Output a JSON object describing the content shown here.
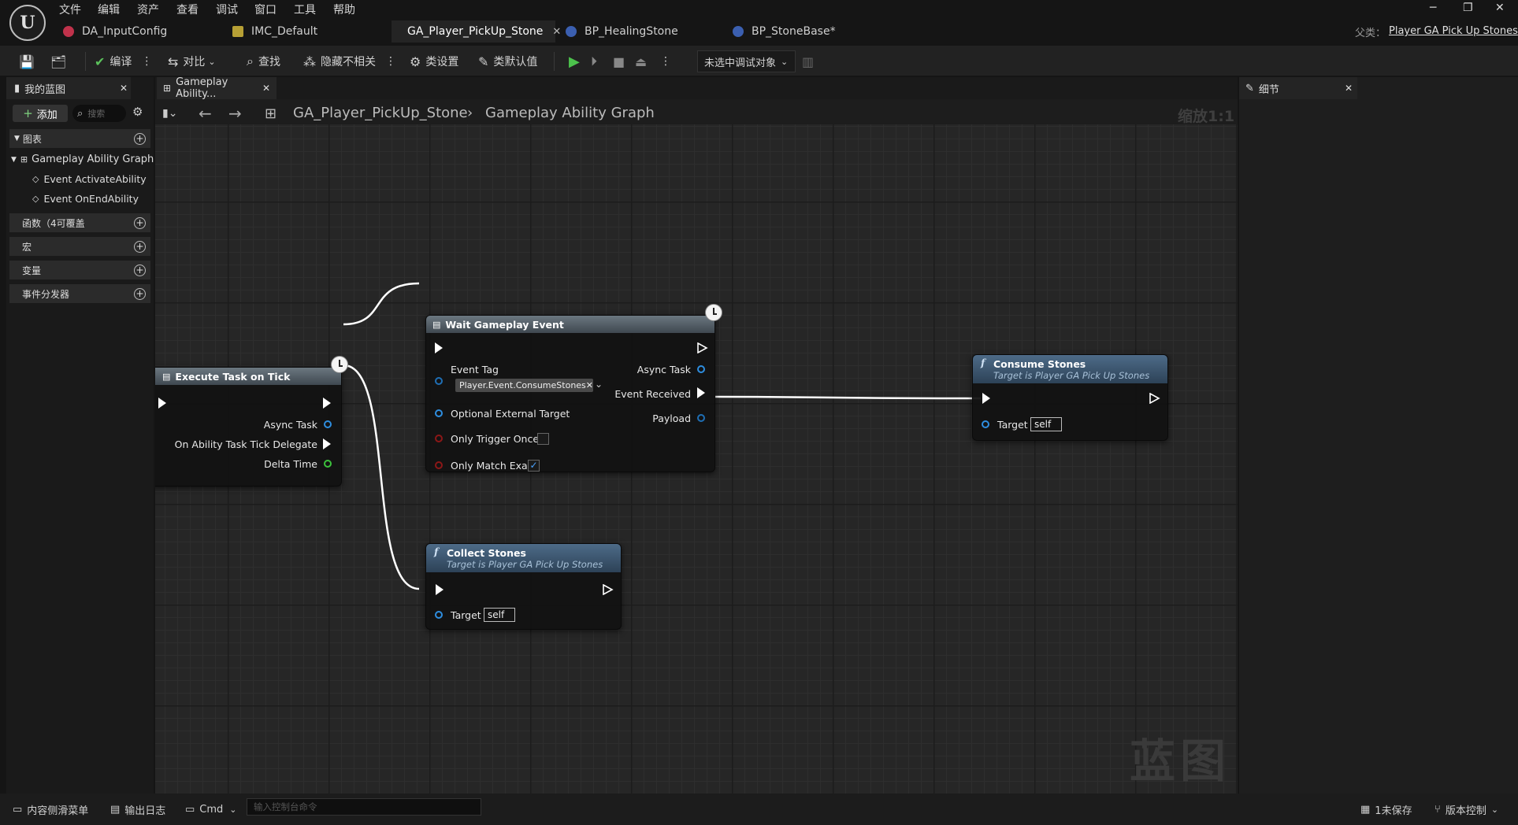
{
  "menu": [
    "文件",
    "编辑",
    "资产",
    "查看",
    "调试",
    "窗口",
    "工具",
    "帮助"
  ],
  "tabs": [
    {
      "label": "DA_InputConfig",
      "icon": "data-asset-icon",
      "color": "#c0324b",
      "active": false
    },
    {
      "label": "IMC_Default",
      "icon": "mapping-context-icon",
      "color": "#b7a035",
      "active": false
    },
    {
      "label": "GA_Player_PickUp_Stone",
      "icon": "blueprint-icon",
      "color": "#2f6fa8",
      "active": true
    },
    {
      "label": "BP_HealingStone",
      "icon": "blueprint-icon",
      "color": "#3b5fb0",
      "active": false
    },
    {
      "label": "BP_StoneBase*",
      "icon": "blueprint-icon",
      "color": "#3b5fb0",
      "active": false
    }
  ],
  "parent": {
    "label": "父类：",
    "value": "Player GA Pick Up Stones"
  },
  "toolbar": {
    "compile": "编译",
    "diff": "对比",
    "find": "查找",
    "hide_unrelated": "隐藏不相关",
    "class_settings": "类设置",
    "class_defaults": "类默认值",
    "debug_target": "未选中调试对象"
  },
  "left_panel": {
    "tab": "我的蓝图",
    "add": "添加",
    "search_placeholder": "搜索",
    "graphs_section": "图表",
    "graph_name": "Gameplay Ability Graph",
    "events": [
      "Event ActivateAbility",
      "Event OnEndAbility"
    ],
    "functions_section": "函数（4可覆盖",
    "macros_section": "宏",
    "variables_section": "变量",
    "dispatchers_section": "事件分发器"
  },
  "graph_tab": "Gameplay Ability...",
  "breadcrumb": {
    "asset": "GA_Player_PickUp_Stone",
    "graph": "Gameplay Ability Graph"
  },
  "zoom": "缩放1:1",
  "watermark": "蓝图",
  "nodes": {
    "execute_task": {
      "title": "Execute Task on Tick",
      "async_task": "Async Task",
      "delegate": "On Ability Task Tick Delegate",
      "delta_time": "Delta Time"
    },
    "wait_event": {
      "title": "Wait Gameplay Event",
      "event_tag": "Event Tag",
      "tag_value": "Player.Event.ConsumeStones",
      "async_task": "Async Task",
      "event_received": "Event Received",
      "payload": "Payload",
      "optional_target": "Optional External Target",
      "only_trigger_once": "Only Trigger Once",
      "only_match_exact": "Only Match Exact",
      "only_trigger_once_checked": false,
      "only_match_exact_checked": true
    },
    "consume": {
      "title": "Consume Stones",
      "subtitle": "Target is Player GA Pick Up Stones",
      "target": "Target",
      "target_value": "self"
    },
    "collect": {
      "title": "Collect Stones",
      "subtitle": "Target is Player GA Pick Up Stones",
      "target": "Target",
      "target_value": "self"
    }
  },
  "right_panel": {
    "tab": "细节"
  },
  "status": {
    "content_drawer": "内容侧滑菜单",
    "output_log": "输出日志",
    "cmd": "Cmd",
    "cmd_placeholder": "输入控制台命令",
    "unsaved": "1未保存",
    "source_control": "版本控制"
  },
  "colors": {
    "exec": "#ffffff",
    "object_pin": "#2e8ee0",
    "bool_pin": "#8c1717",
    "float_pin": "#3cc23c",
    "fn_header": "#3c5874",
    "task_header": "#5a6670"
  }
}
